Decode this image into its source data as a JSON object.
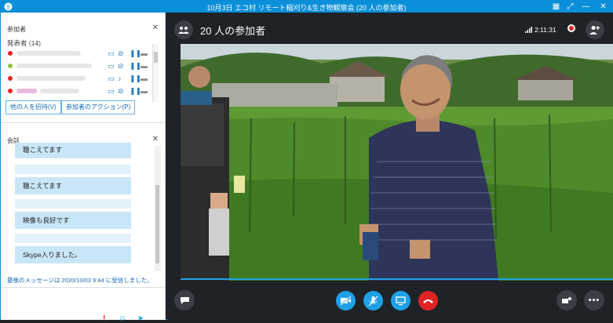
{
  "titlebar": {
    "title": "10月3日 エコ村 リモート稲刈り&生き物観察会 (20 人の参加者)"
  },
  "participants_panel": {
    "heading": "参加者",
    "presenters_label": "発表者 (14)",
    "invite_button": "他の人を招待(V)",
    "actions_button": "参加者のアクション(P)",
    "rows": [
      {
        "status": "#e02424"
      },
      {
        "status": "#8cc63f"
      },
      {
        "status": "#e02424"
      },
      {
        "status": "#e02424"
      }
    ]
  },
  "conversation": {
    "heading": "会話",
    "messages": [
      {
        "text": "聴こえてます"
      },
      {
        "text": "聴こえてます"
      },
      {
        "text": "映像も良好です"
      },
      {
        "text": "Skype入りました。"
      }
    ],
    "last_message": "最後のメッセージは 2020/10/03 9:44 に受信しました。"
  },
  "call": {
    "title": "20 人の参加者",
    "timer": "2:11:31"
  },
  "colors": {
    "accent": "#0a8fd8",
    "hangup": "#e02424",
    "control": "#1ea1e6"
  }
}
